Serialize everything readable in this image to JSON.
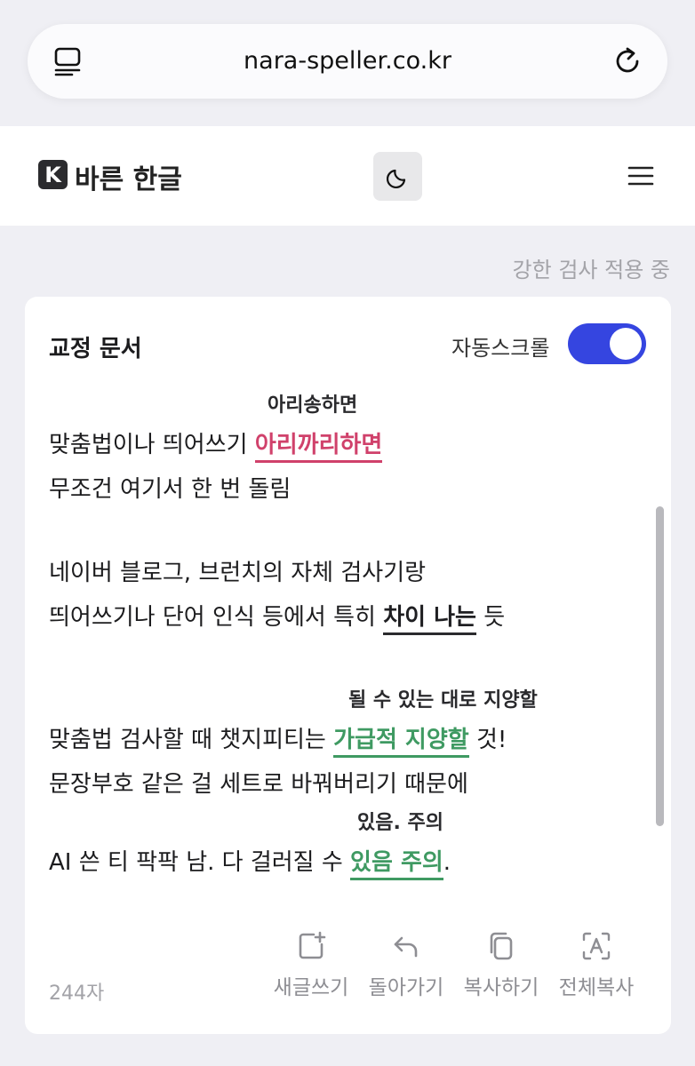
{
  "browser": {
    "url": "nara-speller.co.kr"
  },
  "header": {
    "logo_letter": "K",
    "brand": "바른 한글"
  },
  "status": {
    "strict_mode": "강한 검사 적용 중"
  },
  "card": {
    "title": "교정 문서",
    "autoscroll_label": "자동스크롤",
    "autoscroll_on": true
  },
  "document": {
    "line1": {
      "before": "맞춤법이나 띄어쓰기 ",
      "error": "아리까리하면",
      "suggestion": "아리송하면"
    },
    "line2": {
      "text": "무조건 여기서 한 번 돌림"
    },
    "line3": {
      "text": "네이버 블로그, 브런치의 자체 검사기랑"
    },
    "line4": {
      "before": "띄어쓰기나 단어 인식 등에서 특히 ",
      "error": "차이 나는",
      "after": " 듯"
    },
    "line5": {
      "before": "맞춤법 검사할 때 챗지피티는 ",
      "error": "가급적 지양할",
      "after": " 것!",
      "suggestion": "될 수 있는 대로 지양할"
    },
    "line6": {
      "text": "문장부호 같은 걸 세트로 바꿔버리기 때문에"
    },
    "line7": {
      "before": "AI 쓴 티 팍팍 남. 다 걸러질 수 ",
      "error": "있음 주의",
      "after": ".",
      "suggestion": "있음. 주의"
    }
  },
  "footer": {
    "char_count": "244자",
    "actions": [
      {
        "label": "새글쓰기",
        "icon": "new-doc-icon"
      },
      {
        "label": "돌아가기",
        "icon": "undo-icon"
      },
      {
        "label": "복사하기",
        "icon": "copy-icon"
      },
      {
        "label": "전체복사",
        "icon": "copy-all-icon"
      }
    ]
  },
  "colors": {
    "accent": "#3545e0",
    "error_red": "#d0416b",
    "error_green": "#3f9a62",
    "background": "#efeff4"
  }
}
